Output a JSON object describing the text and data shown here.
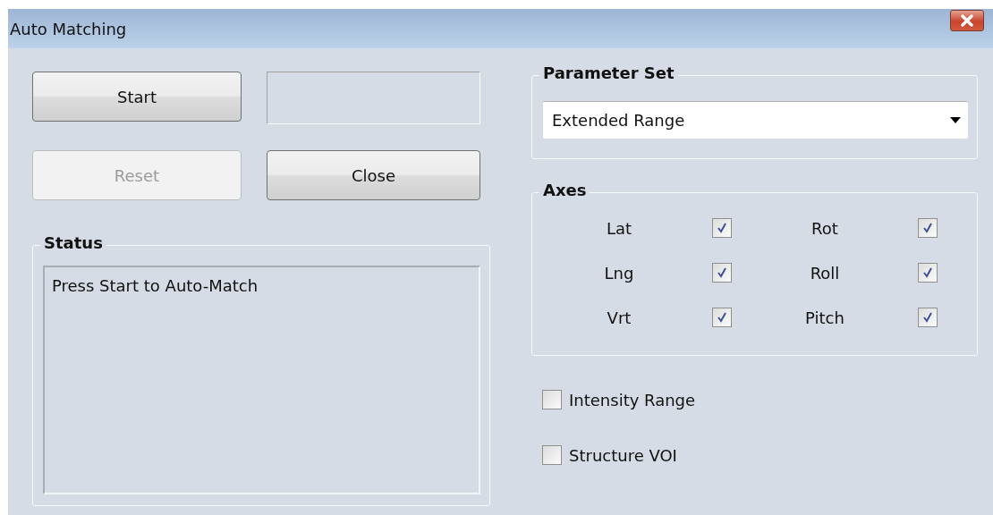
{
  "window": {
    "title": "Auto Matching"
  },
  "buttons": [
    {
      "label": "Start",
      "disabled": false
    },
    {
      "label": "Reset",
      "disabled": true
    },
    {
      "label": "Close",
      "disabled": false
    }
  ],
  "status": {
    "title": "Status",
    "text": "Press Start to Auto-Match"
  },
  "parameter_set": {
    "title": "Parameter Set",
    "value": "Extended Range"
  },
  "axes": {
    "title": "Axes",
    "items": [
      {
        "label": "Lat",
        "checked": true
      },
      {
        "label": "Rot",
        "checked": true
      },
      {
        "label": "Lng",
        "checked": true
      },
      {
        "label": "Roll",
        "checked": true
      },
      {
        "label": "Vrt",
        "checked": true
      },
      {
        "label": "Pitch",
        "checked": true
      }
    ]
  },
  "options": [
    {
      "label": "Intensity Range",
      "checked": false
    },
    {
      "label": "Structure VOI",
      "checked": false
    }
  ]
}
